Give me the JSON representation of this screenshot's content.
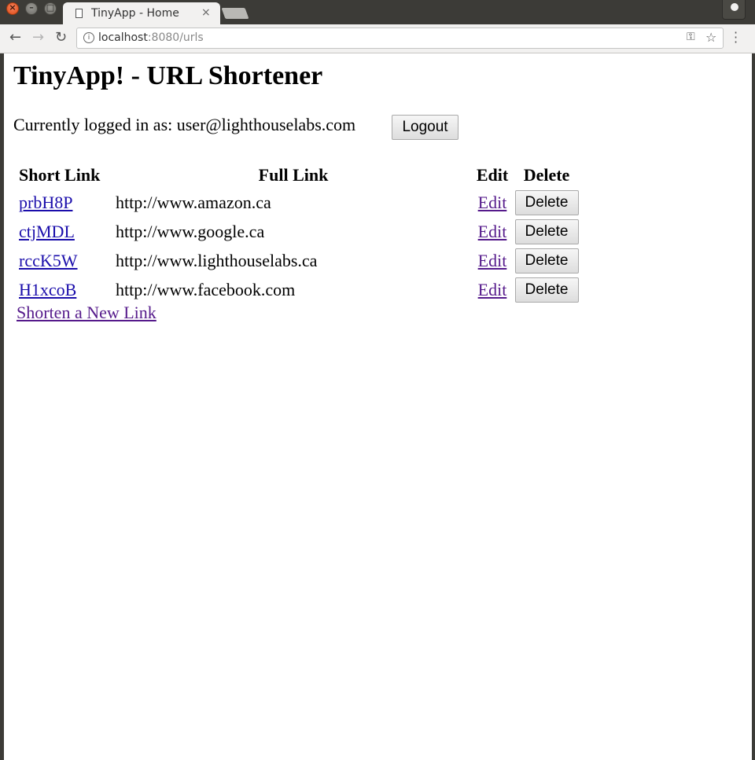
{
  "browser": {
    "tab_title": "TinyApp - Home",
    "tab_close": "×",
    "url_host": "localhost",
    "url_rest": ":8080/urls"
  },
  "page": {
    "heading": "TinyApp! - URL Shortener",
    "login_text": "Currently logged in as: user@lighthouselabs.com",
    "logout_label": "Logout",
    "table": {
      "headers": [
        "Short Link",
        "Full Link",
        "Edit",
        "Delete"
      ],
      "rows": [
        {
          "short": "prbH8P",
          "full": "http://www.amazon.ca",
          "edit": "Edit",
          "delete": "Delete"
        },
        {
          "short": "ctjMDL",
          "full": "http://www.google.ca",
          "edit": "Edit",
          "delete": "Delete"
        },
        {
          "short": "rccK5W",
          "full": "http://www.lighthouselabs.ca",
          "edit": "Edit",
          "delete": "Delete"
        },
        {
          "short": "H1xcoB",
          "full": "http://www.facebook.com",
          "edit": "Edit",
          "delete": "Delete"
        }
      ]
    },
    "shorten_link": "Shorten a New Link"
  },
  "colors": {
    "link": "#1a0dab",
    "visited_link": "#551a8b",
    "window_chrome": "#3c3b37"
  }
}
